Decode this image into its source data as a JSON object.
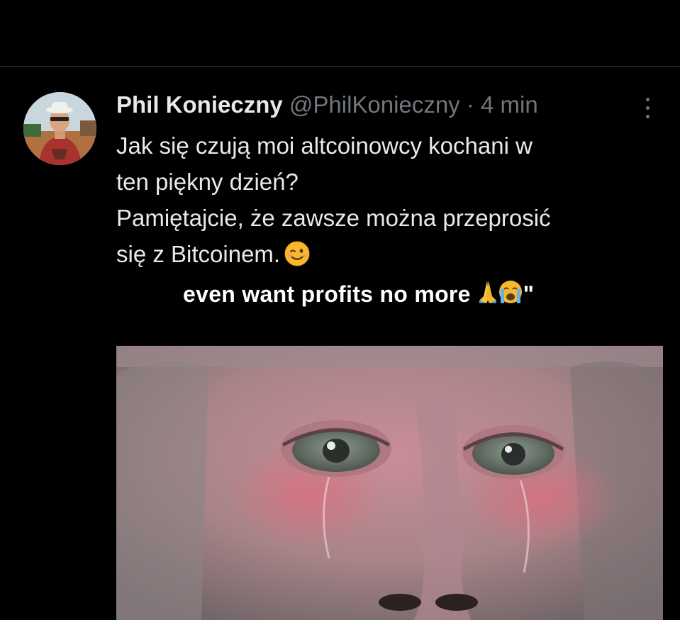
{
  "tweet": {
    "author_name": "Phil Konieczny",
    "author_handle": "@PhilKonieczny",
    "separator": "·",
    "timestamp": "4 min",
    "text_lines": [
      "Jak się czują moi altcoinowcy kochani w",
      "ten piękny dzień?",
      "Pamiętajcie, że zawsze można przeprosić",
      "się z Bitcoinem."
    ],
    "emoji": "winking-face-emoji"
  },
  "media": {
    "caption": "even want profits no more",
    "caption_suffix": "\"",
    "caption_emojis": [
      "folded-hands-emoji",
      "crying-face-emoji"
    ],
    "image": "crying-monkey-closeup"
  },
  "colors": {
    "background": "#000000",
    "text_primary": "#e7e9ea",
    "text_secondary": "#71767b",
    "divider": "#2f3336"
  }
}
